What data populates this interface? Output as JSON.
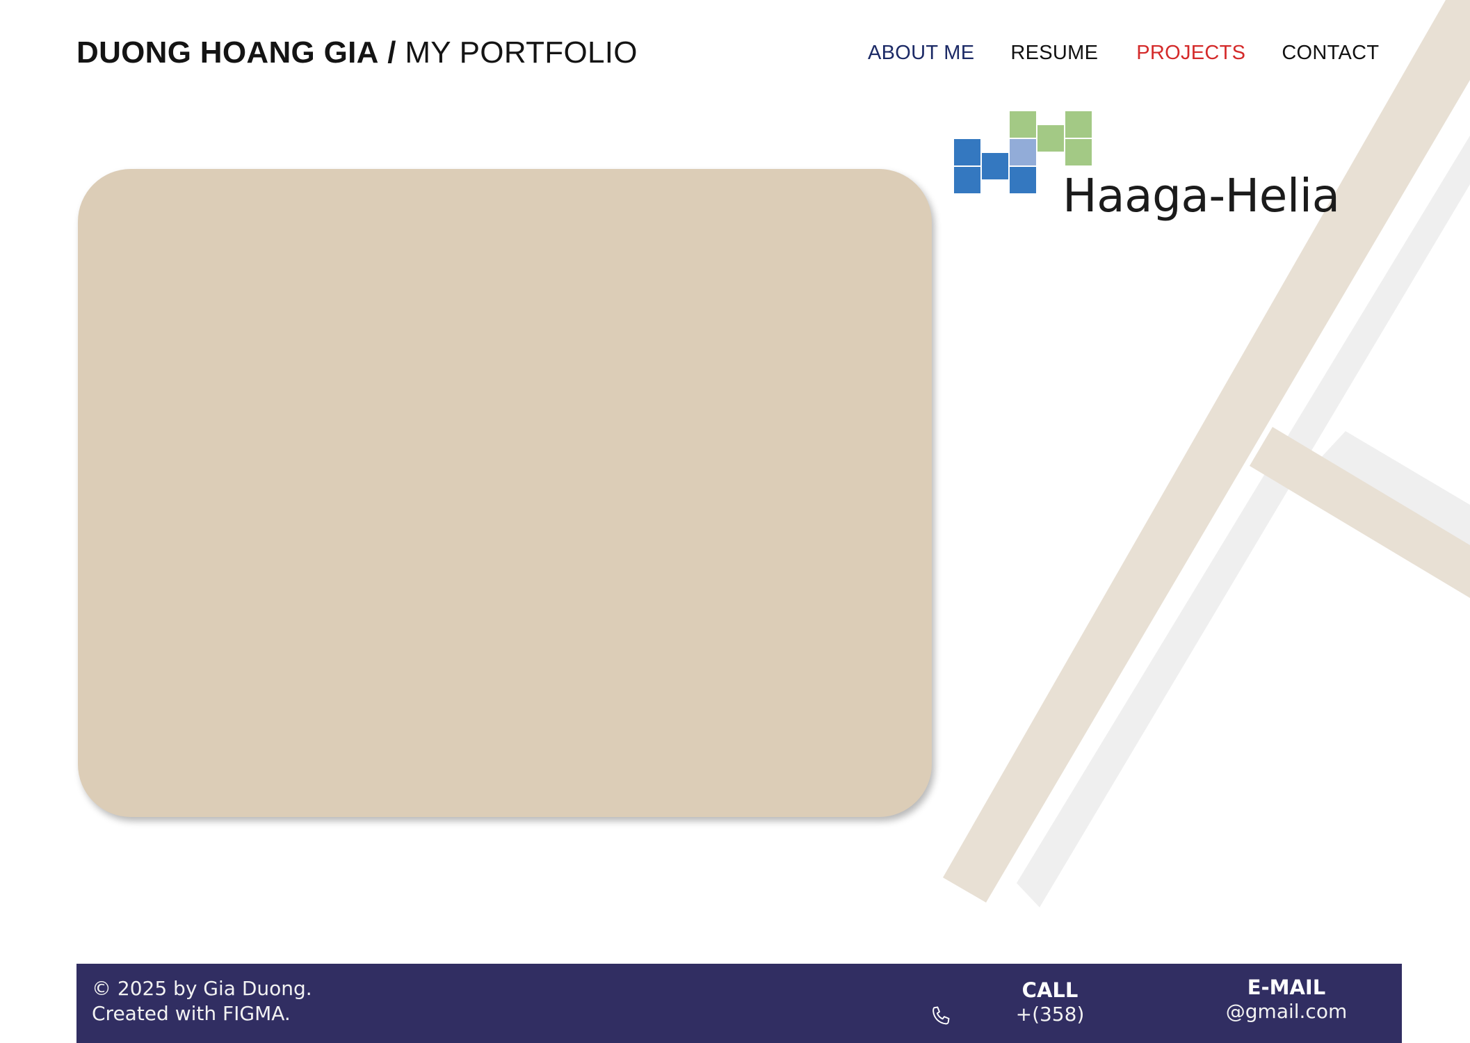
{
  "header": {
    "name": "DUONG HOANG GIA",
    "separator": "/",
    "subtitle": "MY PORTFOLIO"
  },
  "nav": {
    "items": [
      {
        "label": "ABOUT ME",
        "color": "#1c2a66"
      },
      {
        "label": "RESUME",
        "color": "#111111"
      },
      {
        "label": "PROJECTS",
        "color": "#d42a2a",
        "active": true
      },
      {
        "label": "CONTACT",
        "color": "#111111"
      }
    ]
  },
  "logo": {
    "text": "Haaga-Helia",
    "colors": {
      "blue": "#3478c0",
      "light_blue": "#92acd8",
      "green": "#a3c985"
    }
  },
  "project_card": {
    "color": "#dccdb7"
  },
  "footer": {
    "background": "#312e62",
    "copyright_line1": "© 2025 by Gia Duong.",
    "copyright_line2": "Created with FIGMA.",
    "call_label": "CALL",
    "call_value": "+(358)",
    "email_label": "E-MAIL",
    "email_value": "@gmail.com",
    "phone_icon": "phone-icon"
  },
  "decoration": {
    "bar_color": "#e8e0d4",
    "shadow_color": "#efefef"
  }
}
